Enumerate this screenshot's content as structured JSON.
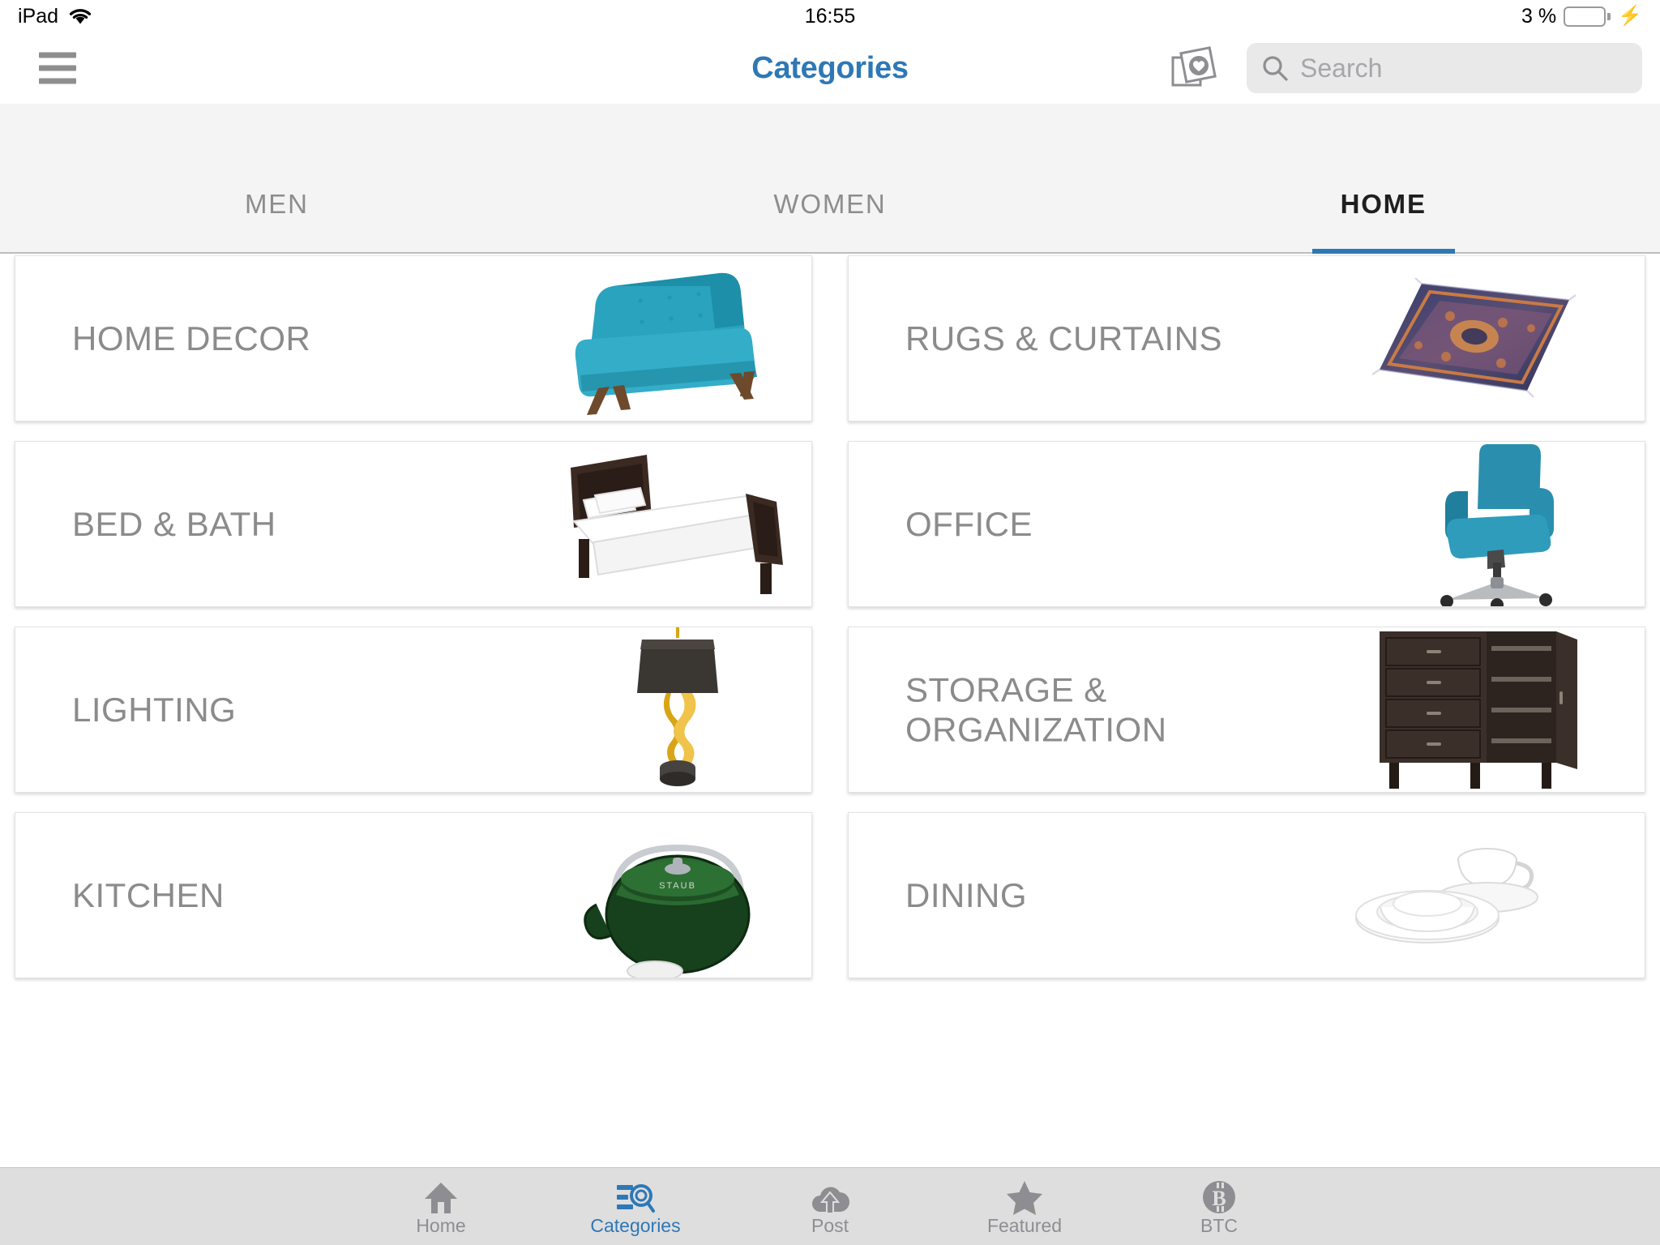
{
  "status_bar": {
    "carrier": "iPad",
    "wifi_icon": "wifi-icon",
    "time": "16:55",
    "battery_percent": "3 %",
    "battery_level": 3,
    "battery_icon": "battery-icon",
    "charging_icon": "lightning-bolt-icon"
  },
  "nav_bar": {
    "menu_icon": "hamburger-menu-icon",
    "title": "Categories",
    "camera_icon": "photos-camera-icon",
    "search": {
      "icon": "search-icon",
      "placeholder": "Search",
      "value": ""
    }
  },
  "segment_tabs": {
    "items": [
      {
        "label": "MEN",
        "active": false
      },
      {
        "label": "WOMEN",
        "active": false
      },
      {
        "label": "HOME",
        "active": true
      }
    ],
    "active_index": 2,
    "indicator_color": "#2e78b5"
  },
  "categories": {
    "rows": [
      [
        {
          "label": "HOME DECOR",
          "art": "armchair"
        },
        {
          "label": "RUGS & CURTAINS",
          "art": "rug"
        }
      ],
      [
        {
          "label": "BED & BATH",
          "art": "bed"
        },
        {
          "label": "OFFICE",
          "art": "office-chair"
        }
      ],
      [
        {
          "label": "LIGHTING",
          "art": "table-lamp"
        },
        {
          "label": "STORAGE & ORGANIZATION",
          "art": "cabinet"
        }
      ],
      [
        {
          "label": "KITCHEN",
          "art": "kettle"
        },
        {
          "label": "DINING",
          "art": "dishes"
        }
      ]
    ]
  },
  "bottom_tab_bar": {
    "items": [
      {
        "label": "Home",
        "icon": "home-icon",
        "active": false
      },
      {
        "label": "Categories",
        "icon": "categories-list-search-icon",
        "active": true
      },
      {
        "label": "Post",
        "icon": "cloud-upload-icon",
        "active": false
      },
      {
        "label": "Featured",
        "icon": "star-icon",
        "active": false
      },
      {
        "label": "BTC",
        "icon": "bitcoin-icon",
        "active": false
      }
    ],
    "active_index": 1,
    "active_color": "#2e78b5",
    "inactive_color": "#8e8e92"
  },
  "colors": {
    "accent_blue": "#2e78b5",
    "card_label_gray": "#8b8b8b",
    "page_background": "#ffffff",
    "tabs_background": "#f4f4f4",
    "tabbar_background": "#dededf",
    "battery_red": "#ff2b20"
  }
}
